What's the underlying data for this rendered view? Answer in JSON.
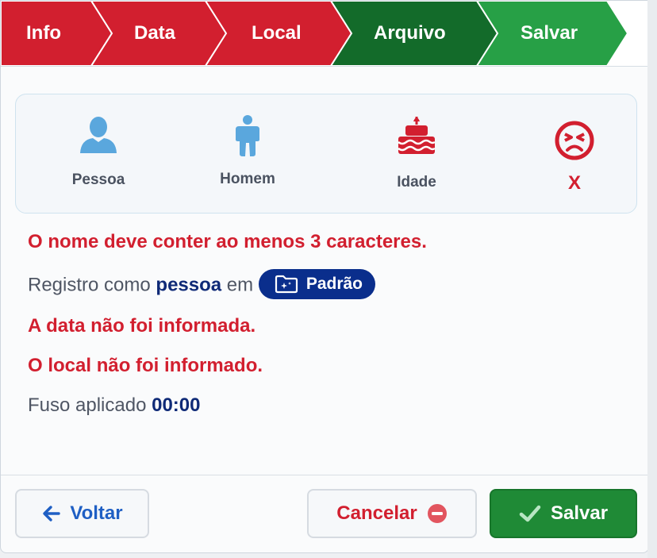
{
  "stepper": {
    "steps": [
      {
        "label": "Info",
        "state": "done",
        "color": "#d21f2f"
      },
      {
        "label": "Data",
        "state": "done",
        "color": "#d21f2f"
      },
      {
        "label": "Local",
        "state": "done",
        "color": "#d21f2f"
      },
      {
        "label": "Arquivo",
        "state": "current",
        "color": "#136b2a"
      },
      {
        "label": "Salvar",
        "state": "pending",
        "color": "#27a046"
      }
    ]
  },
  "summary_card": {
    "items": [
      {
        "label": "Pessoa",
        "icon": "person-bust-icon",
        "color": "#5aa7dd"
      },
      {
        "label": "Homem",
        "icon": "man-icon",
        "color": "#5aa7dd"
      },
      {
        "label": "Idade",
        "icon": "birthday-cake-icon",
        "color": "#d21f2f"
      },
      {
        "label": "X",
        "icon": "angry-face-icon",
        "color": "#d21f2f"
      }
    ]
  },
  "messages": {
    "name_error": "O nome deve conter ao menos 3 caracteres.",
    "register_prefix": "Registro como",
    "register_type": "pessoa",
    "register_in": "em",
    "folder_name": "Padrão",
    "date_error": "A data não foi informada.",
    "local_error": "O local não foi informado.",
    "timezone_prefix": "Fuso aplicado",
    "timezone_value": "00:00"
  },
  "footer": {
    "back_label": "Voltar",
    "cancel_label": "Cancelar",
    "save_label": "Salvar"
  }
}
